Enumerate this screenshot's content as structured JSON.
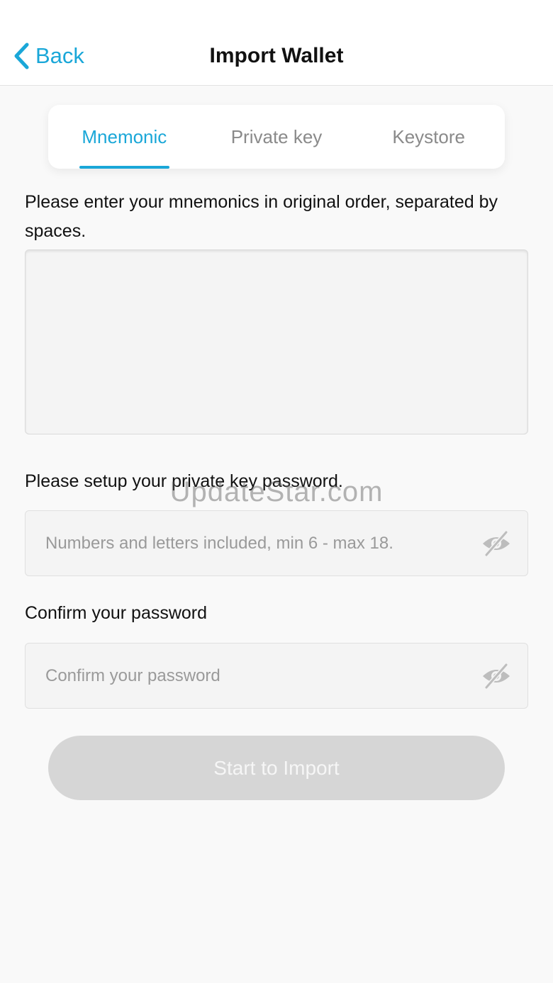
{
  "header": {
    "back_label": "Back",
    "title": "Import Wallet"
  },
  "tabs": [
    {
      "label": "Mnemonic",
      "active": true
    },
    {
      "label": "Private key",
      "active": false
    },
    {
      "label": "Keystore",
      "active": false
    }
  ],
  "mnemonic": {
    "instruction": "Please enter your mnemonics in original order, separated by spaces.",
    "value": ""
  },
  "password": {
    "label": "Please setup your private key password.",
    "placeholder": "Numbers and letters included, min 6 - max 18.",
    "value": ""
  },
  "confirm": {
    "label": "Confirm your password",
    "placeholder": "Confirm your password",
    "value": ""
  },
  "watermark": "UpdateStar.com",
  "import_button_label": "Start to Import",
  "colors": {
    "accent": "#1aa7d8",
    "disabled_button": "#d6d6d6",
    "background": "#f9f9f9"
  },
  "icons": {
    "back": "chevron-left-icon",
    "password_visibility": "eye-off-icon"
  }
}
